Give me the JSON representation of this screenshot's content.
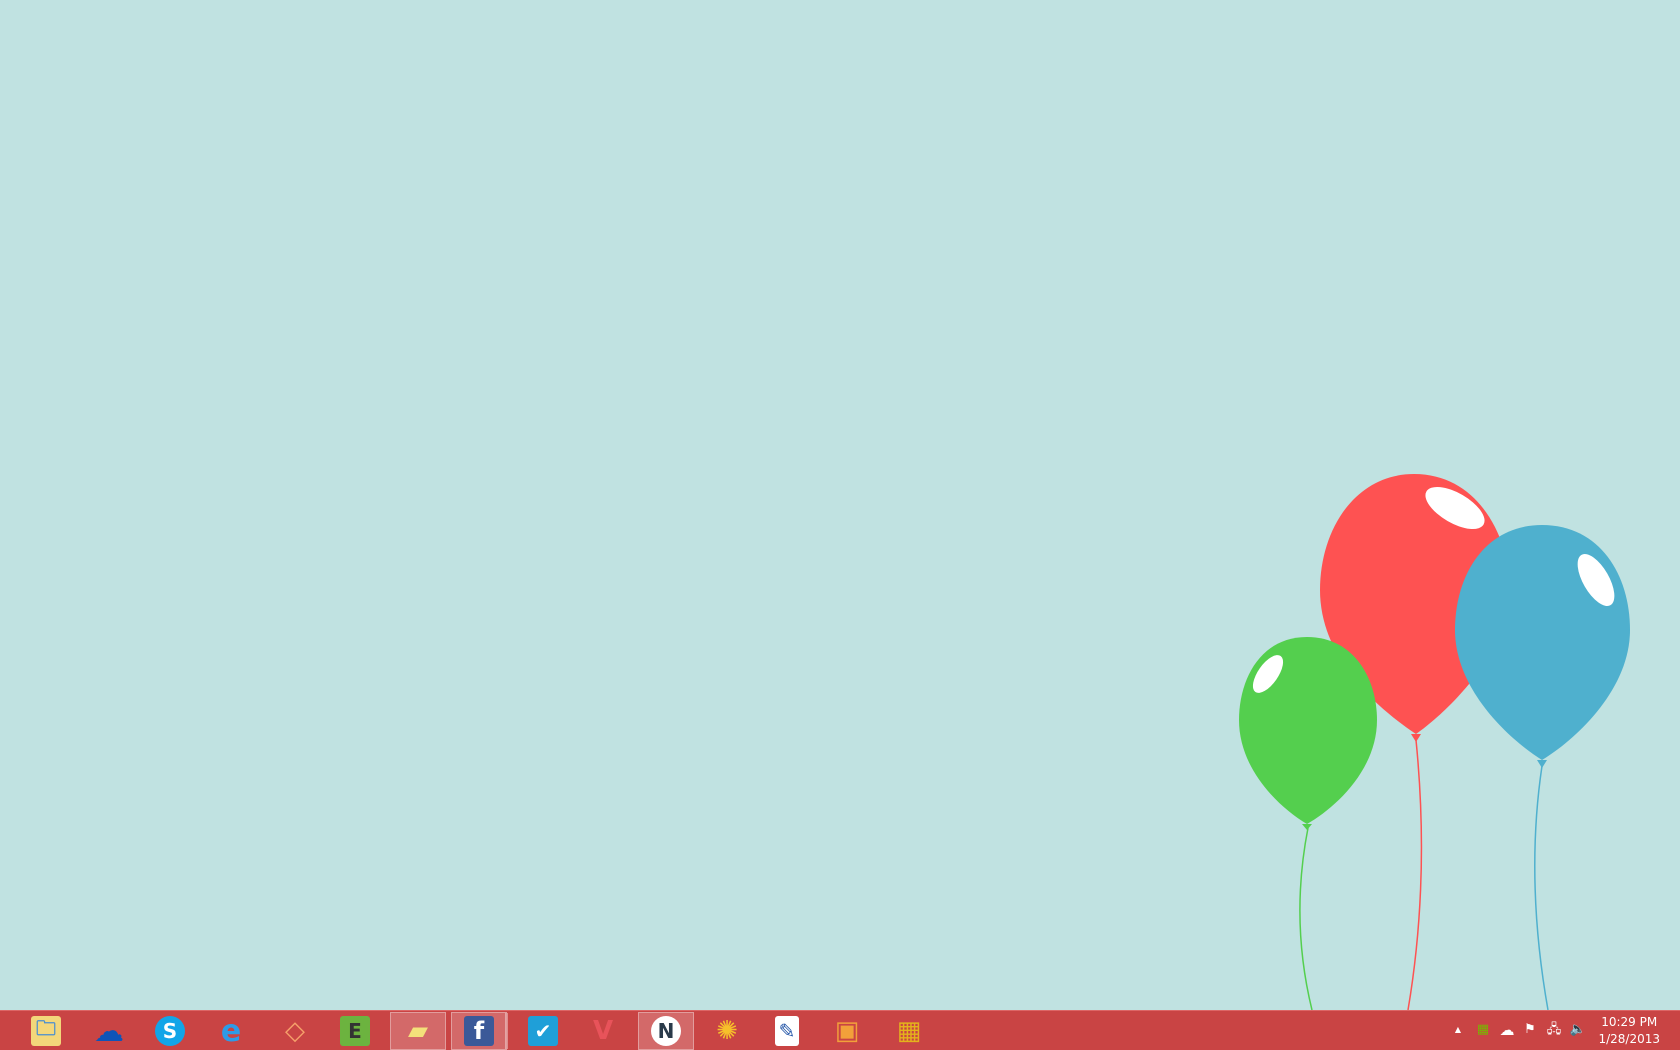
{
  "wallpaper": {
    "background": "#c0e2e1",
    "balloons": [
      {
        "name": "red",
        "color": "#fe5252"
      },
      {
        "name": "blue",
        "color": "#4fb0ce"
      },
      {
        "name": "green",
        "color": "#54cf4e"
      }
    ]
  },
  "taskbar": {
    "color": "#c94444",
    "apps": [
      {
        "name": "file-explorer",
        "glyph": "🗀"
      },
      {
        "name": "skydrive",
        "glyph": "☁"
      },
      {
        "name": "skype",
        "glyph": "S"
      },
      {
        "name": "internet-explorer",
        "glyph": "e"
      },
      {
        "name": "app-geometric",
        "glyph": "◇"
      },
      {
        "name": "evernote",
        "glyph": "E"
      },
      {
        "name": "sticky-notes",
        "glyph": "▰"
      },
      {
        "name": "facebook",
        "glyph": "f"
      },
      {
        "name": "foursquare",
        "glyph": "✔"
      },
      {
        "name": "app-v",
        "glyph": "V"
      },
      {
        "name": "app-n",
        "glyph": "N"
      },
      {
        "name": "nbc",
        "glyph": "✺"
      },
      {
        "name": "paint-app",
        "glyph": "✎"
      },
      {
        "name": "photo-app",
        "glyph": "▣"
      },
      {
        "name": "app-blocks",
        "glyph": "▦"
      }
    ],
    "tray": {
      "show_hidden": "▲",
      "time": "10:29 PM",
      "date": "1/28/2013"
    }
  }
}
